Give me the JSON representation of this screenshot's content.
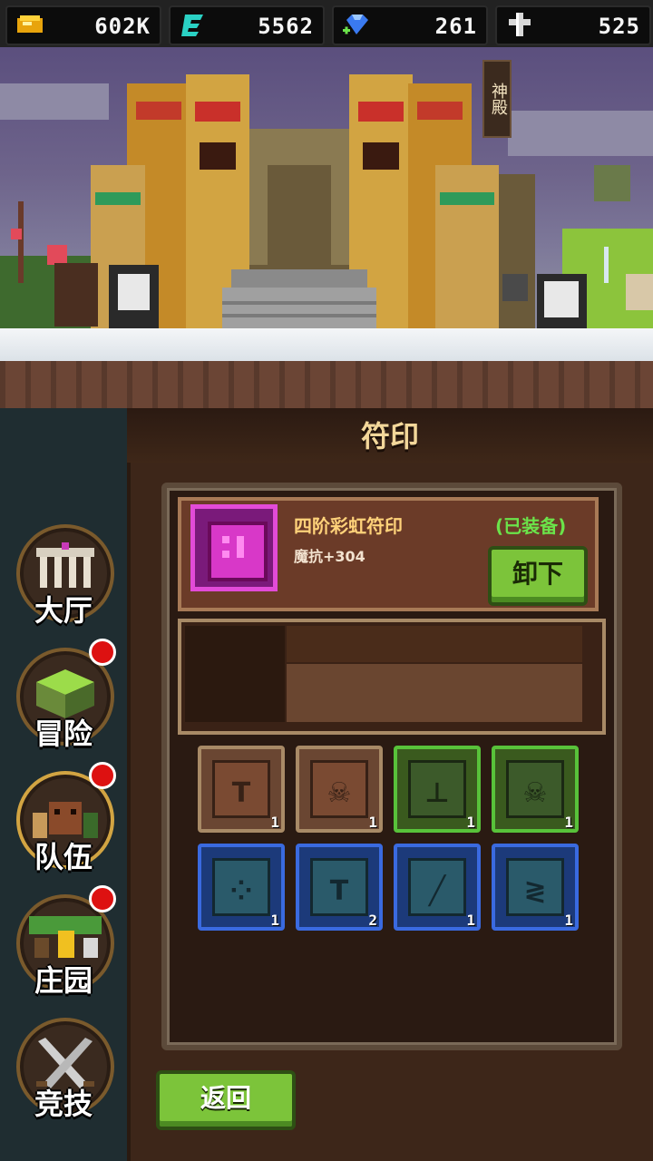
{
  "resources": [
    {
      "icon": "gold-coin-icon",
      "value": "602K"
    },
    {
      "icon": "energy-e-icon",
      "value": "5562"
    },
    {
      "icon": "gem-icon",
      "value": "261"
    },
    {
      "icon": "cross-icon",
      "value": "525"
    }
  ],
  "scene": {
    "sign": "神殿"
  },
  "nav": [
    {
      "label": "大厅",
      "badge": false
    },
    {
      "label": "冒险",
      "badge": true
    },
    {
      "label": "队伍",
      "badge": true
    },
    {
      "label": "庄园",
      "badge": true
    },
    {
      "label": "竞技",
      "badge": false
    }
  ],
  "panel": {
    "title": "符印"
  },
  "equipped": {
    "name": "四阶彩虹符印",
    "status": "(已装备)",
    "stat": "魔抗+304",
    "unequip_label": "卸下"
  },
  "inventory": [
    {
      "tier": "brown",
      "icon": "hammer-rune-icon",
      "count": "1"
    },
    {
      "tier": "brown",
      "icon": "skull-rune-icon",
      "count": "1"
    },
    {
      "tier": "green",
      "icon": "tree-rune-icon",
      "count": "1"
    },
    {
      "tier": "green",
      "icon": "skull-rune-icon",
      "count": "1"
    },
    {
      "tier": "blue",
      "icon": "dots-rune-icon",
      "count": "1"
    },
    {
      "tier": "blue",
      "icon": "hammer-rune-icon",
      "count": "2"
    },
    {
      "tier": "blue",
      "icon": "slash-rune-icon",
      "count": "1"
    },
    {
      "tier": "blue",
      "icon": "zigzag-rune-icon",
      "count": "1"
    }
  ],
  "back_label": "返回"
}
